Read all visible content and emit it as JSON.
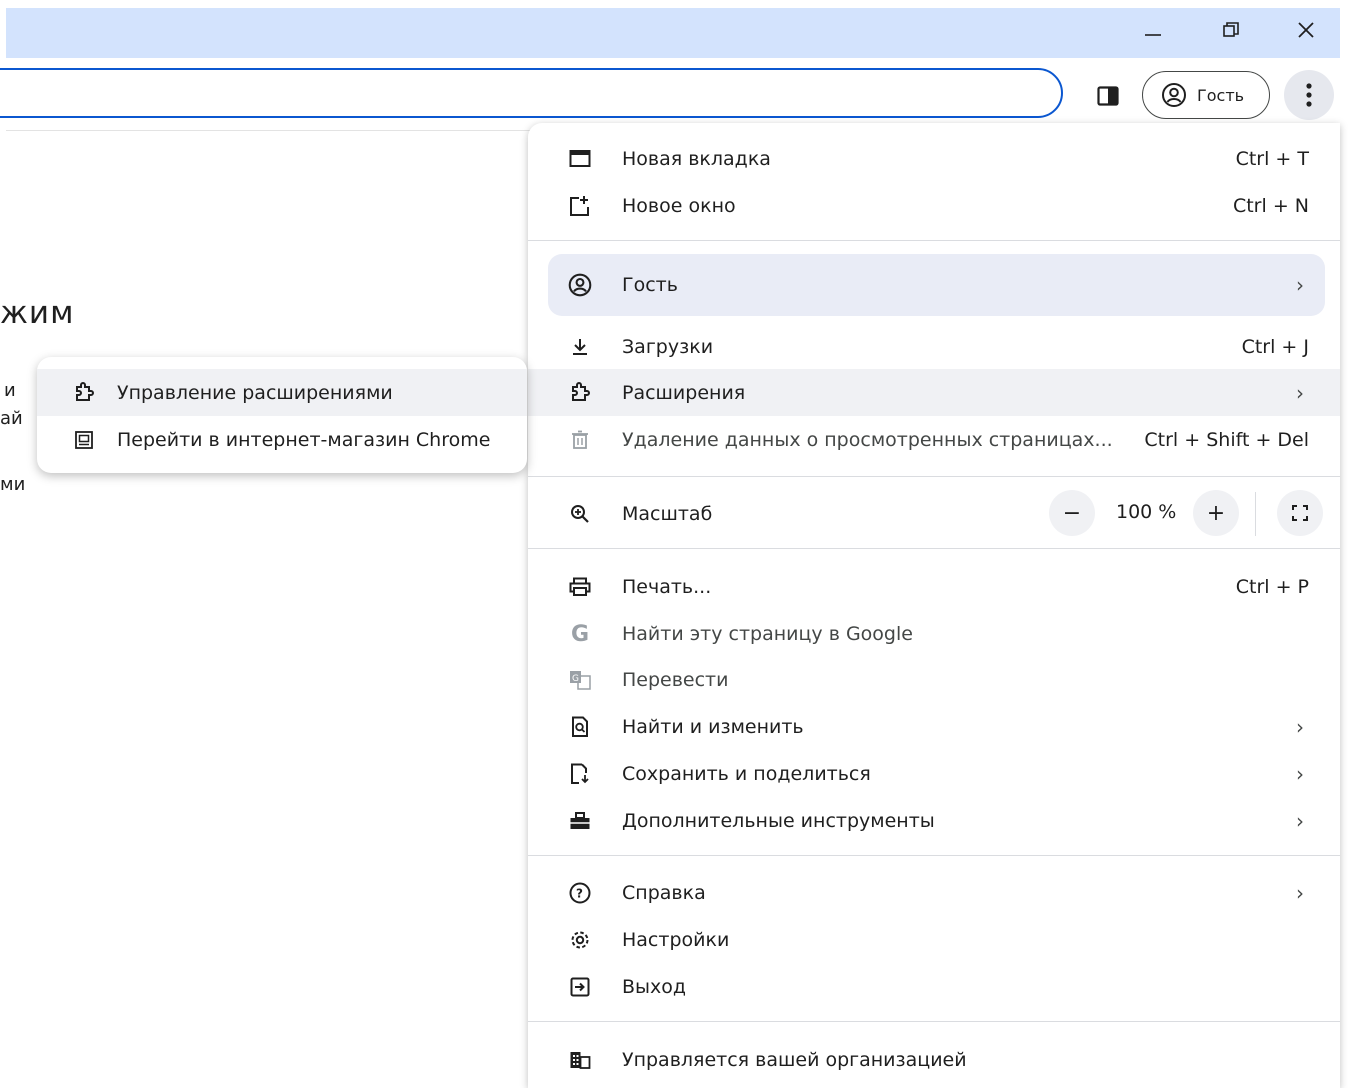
{
  "titlebar": {
    "minimize_icon": "minimize-icon",
    "restore_icon": "restore-icon",
    "close_icon": "close-icon"
  },
  "toolbar": {
    "profile_label": "Гость"
  },
  "page": {
    "heading_fragment": "жим",
    "frag1": "и",
    "frag2": "ай",
    "frag3": "ми"
  },
  "menu": {
    "new_tab": {
      "label": "Новая вкладка",
      "shortcut": "Ctrl + T"
    },
    "new_window": {
      "label": "Новое окно",
      "shortcut": "Ctrl + N"
    },
    "guest": {
      "label": "Гость"
    },
    "downloads": {
      "label": "Загрузки",
      "shortcut": "Ctrl + J"
    },
    "extensions": {
      "label": "Расширения"
    },
    "clear_data": {
      "label": "Удаление данных о просмотренных страницах...",
      "shortcut": "Ctrl + Shift + Del"
    },
    "zoom": {
      "label": "Масштаб",
      "value": "100 %",
      "minus": "−",
      "plus": "+"
    },
    "print": {
      "label": "Печать...",
      "shortcut": "Ctrl + P"
    },
    "search_google": {
      "label": "Найти эту страницу в Google"
    },
    "translate": {
      "label": "Перевести"
    },
    "find_edit": {
      "label": "Найти и изменить"
    },
    "save_share": {
      "label": "Сохранить и поделиться"
    },
    "more_tools": {
      "label": "Дополнительные инструменты"
    },
    "help": {
      "label": "Справка"
    },
    "settings": {
      "label": "Настройки"
    },
    "exit": {
      "label": "Выход"
    },
    "managed": {
      "label": "Управляется вашей организацией"
    }
  },
  "submenu": {
    "manage_extensions": {
      "label": "Управление расширениями"
    },
    "web_store": {
      "label": "Перейти в интернет-магазин Chrome"
    }
  },
  "colors": {
    "titlebar_bg": "#d3e3fd",
    "omnibox_border": "#0b57d0",
    "hover_bg": "#f0f1f4"
  }
}
